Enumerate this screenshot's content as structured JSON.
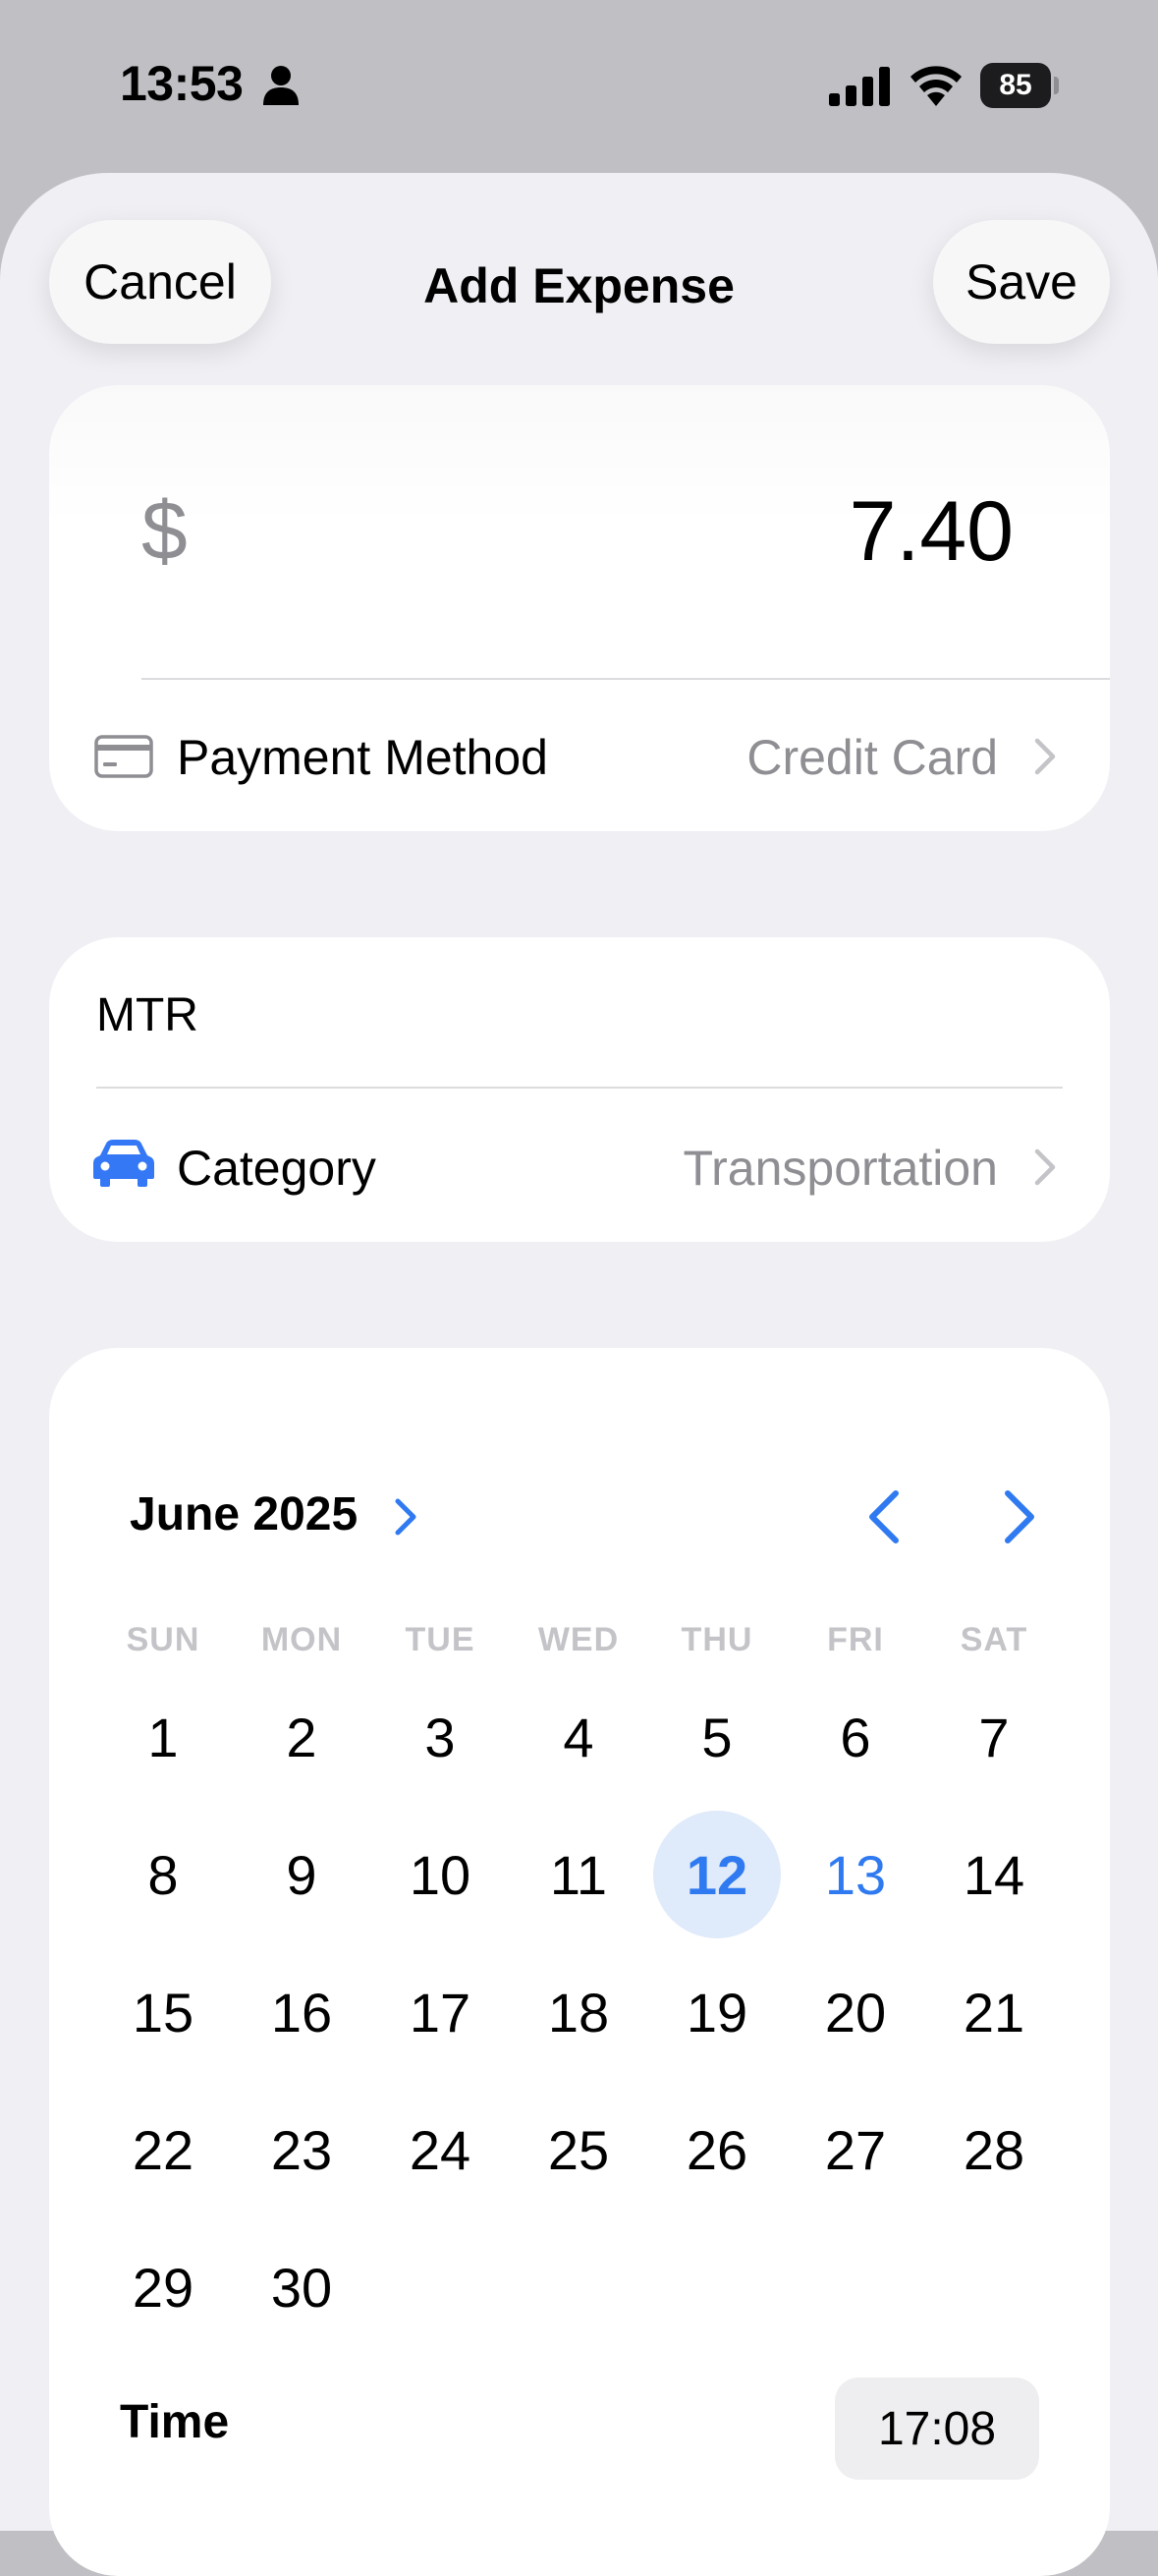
{
  "status_bar": {
    "time": "13:53",
    "battery": "85",
    "icons": [
      "person-icon",
      "signal-icon",
      "wifi-icon",
      "battery-icon"
    ]
  },
  "nav": {
    "cancel_label": "Cancel",
    "title": "Add Expense",
    "save_label": "Save"
  },
  "amount": {
    "currency_symbol": "$",
    "value": "7.40"
  },
  "payment": {
    "label": "Payment Method",
    "value": "Credit Card",
    "icon": "credit-card-icon"
  },
  "description": {
    "value": "MTR"
  },
  "category": {
    "label": "Category",
    "value": "Transportation",
    "icon": "car-icon",
    "icon_color": "#3478f6"
  },
  "calendar": {
    "month_label": "June 2025",
    "weekdays": [
      "SUN",
      "MON",
      "TUE",
      "WED",
      "THU",
      "FRI",
      "SAT"
    ],
    "days": [
      "1",
      "2",
      "3",
      "4",
      "5",
      "6",
      "7",
      "8",
      "9",
      "10",
      "11",
      "12",
      "13",
      "14",
      "15",
      "16",
      "17",
      "18",
      "19",
      "20",
      "21",
      "22",
      "23",
      "24",
      "25",
      "26",
      "27",
      "28",
      "29",
      "30"
    ],
    "selected_day": "12",
    "today_day": "13",
    "accent_color": "#2f7af0"
  },
  "time": {
    "label": "Time",
    "value": "17:08"
  }
}
